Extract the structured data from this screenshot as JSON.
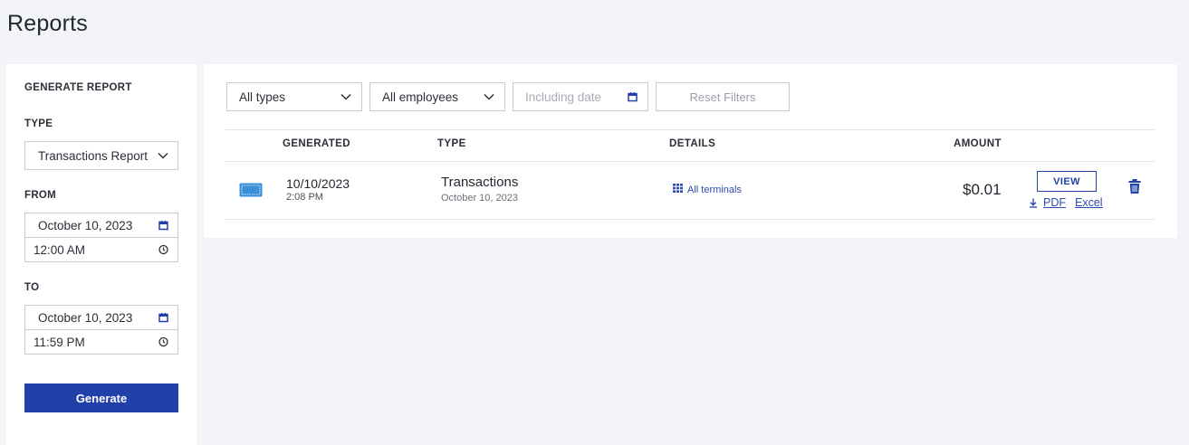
{
  "page": {
    "title": "Reports"
  },
  "generate_panel": {
    "heading": "GENERATE REPORT",
    "type_label": "TYPE",
    "type_value": "Transactions Report",
    "from_label": "FROM",
    "from_date": "October 10, 2023",
    "from_time": "12:00 AM",
    "to_label": "TO",
    "to_date": "October 10, 2023",
    "to_time": "11:59 PM",
    "generate_label": "Generate"
  },
  "filters": {
    "type_value": "All types",
    "employee_value": "All employees",
    "date_placeholder": "Including date",
    "reset_label": "Reset Filters"
  },
  "table": {
    "columns": [
      "GENERATED",
      "TYPE",
      "DETAILS",
      "AMOUNT"
    ],
    "rows": [
      {
        "icon": "payment-card-icon",
        "generated_date": "10/10/2023",
        "generated_time": "2:08 PM",
        "type_title": "Transactions",
        "type_subtitle": "October 10, 2023",
        "details": "All terminals",
        "amount": "$0.01",
        "view_label": "VIEW",
        "pdf_label": "PDF",
        "excel_label": "Excel"
      }
    ]
  },
  "colors": {
    "accent": "#2140a8",
    "link": "#2c4ab0",
    "background": "#f3f4f8",
    "card_icon": "#3a8fd9"
  }
}
